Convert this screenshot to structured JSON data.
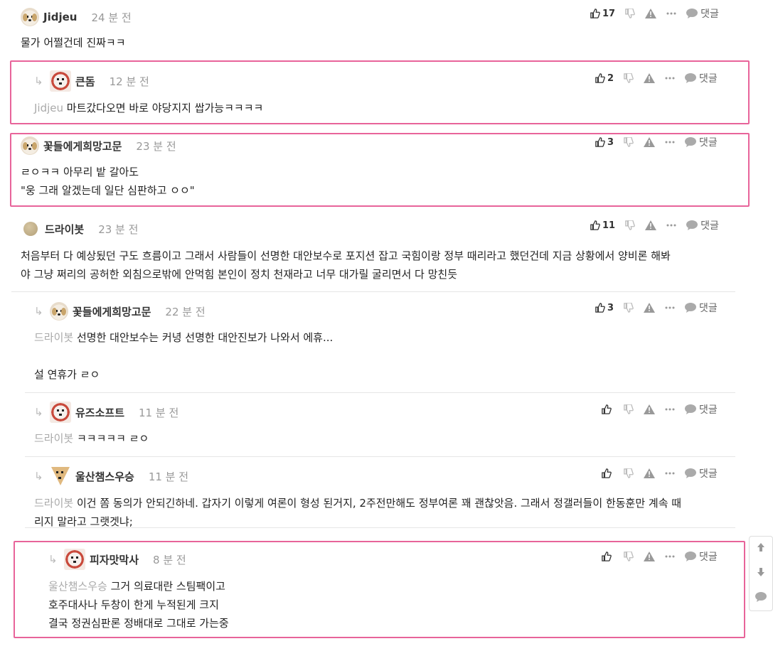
{
  "labels": {
    "reply": "댓글"
  },
  "comments": [
    {
      "author": "Jidjeu",
      "time": "24 분 전",
      "likes": "17",
      "mention": "",
      "text": "물가 어쩔건데 진짜ㅋㅋ",
      "avatar": "dog"
    },
    {
      "author": "큰돔",
      "time": "12 분 전",
      "likes": "2",
      "mention": "Jidjeu",
      "text": " 마트갔다오면 바로 야당지지 쌉가능ㅋㅋㅋㅋ",
      "avatar": "square"
    },
    {
      "author": "꽃들에게희망고문",
      "time": "23 분 전",
      "likes": "3",
      "mention": "",
      "text": "ㄹㅇㅋㅋ 아무리 밭 갈아도\n\"웅 그래 알겠는데 일단 심판하고 ㅇㅇ\"",
      "avatar": "dog"
    },
    {
      "author": "드라이봇",
      "time": "23 분 전",
      "likes": "11",
      "mention": "",
      "text": "처음부터 다 예상됬던 구도 흐름이고 그래서 사람들이 선명한 대안보수로 포지션 잡고 국힘이랑 정부 때리라고 했던건데 지금 상황에서 양비론 해봐\n야 그냥 쩌리의 공허한 외침으로밖에 안먹힘 본인이 정치 천재라고 너무 대가릴 굴리면서 다 망친듯",
      "avatar": "ball"
    },
    {
      "author": "꽃들에게희망고문",
      "time": "22 분 전",
      "likes": "3",
      "mention": "드라이봇",
      "text": " 선명한 대안보수는 커녕 선명한 대안진보가 나와서 에휴...\n\n설 연휴가 ㄹㅇ",
      "avatar": "dog"
    },
    {
      "author": "유즈소프트",
      "time": "11 분 전",
      "likes": "",
      "mention": "드라이봇",
      "text": " ㅋㅋㅋㅋㅋ ㄹㅇ",
      "avatar": "square"
    },
    {
      "author": "울산챔스우승",
      "time": "11 분 전",
      "likes": "",
      "mention": "드라이봇",
      "text": " 이건 쫌 동의가 안되긴하네. 갑자기 이렇게 여론이 형성 된거지, 2주전만해도 정부여론 꽤 괜찮앗음. 그래서 정갤러들이 한동훈만 계속 때\n리지 말라고 그랫겟냐;",
      "avatar": "fox"
    },
    {
      "author": "피자맛막사",
      "time": "8 분 전",
      "likes": "",
      "mention": "울산챔스우승",
      "text": " 그거 의료대란 스팀팩이고\n호주대사나 두창이 한게 누적된게 크지\n결국 정권심판론 정배대로 그대로 가는중",
      "avatar": "square"
    }
  ],
  "colors": {
    "highlight": "#e8649a",
    "mention": "#aaaaaa"
  },
  "side_tools": [
    "arrow-up-icon",
    "arrow-down-icon",
    "speech-bubble-icon"
  ]
}
